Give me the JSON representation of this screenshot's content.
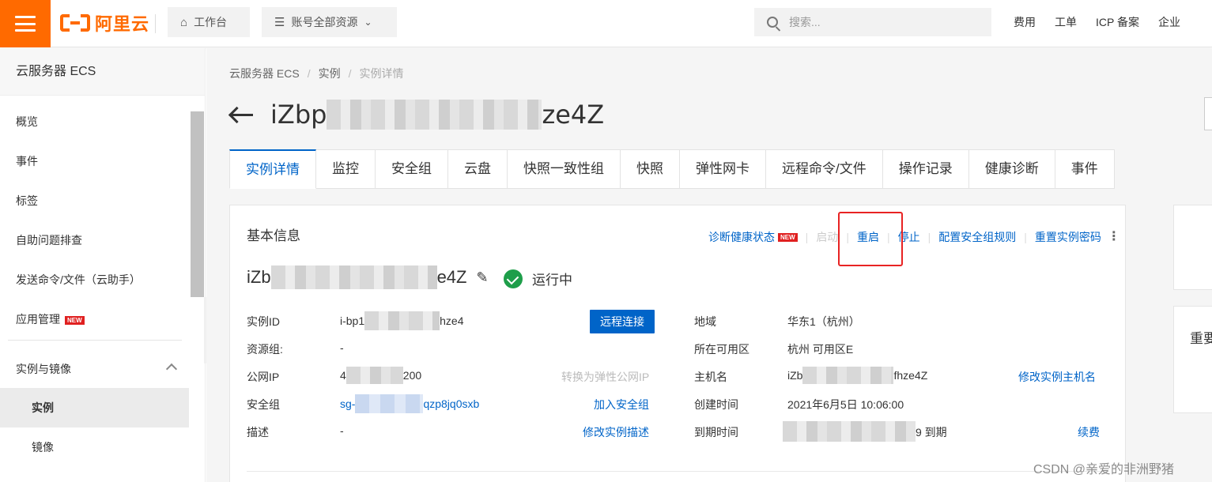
{
  "topbar": {
    "brand": "阿里云",
    "workbench": "工作台",
    "resources": "账号全部资源",
    "search_placeholder": "搜索...",
    "links": [
      "费用",
      "工单",
      "ICP 备案",
      "企业"
    ]
  },
  "sidebar": {
    "title": "云服务器 ECS",
    "items": [
      "概览",
      "事件",
      "标签",
      "自助问题排查",
      "发送命令/文件（云助手）",
      "应用管理"
    ],
    "new_badge": "NEW",
    "group": "实例与镜像",
    "active": "实例",
    "sub": "镜像"
  },
  "breadcrumb": [
    "云服务器 ECS",
    "实例",
    "实例详情"
  ],
  "title": {
    "prefix": "iZbp",
    "suffix": "ze4Z"
  },
  "tabs": [
    "实例详情",
    "监控",
    "安全组",
    "云盘",
    "快照一致性组",
    "快照",
    "弹性网卡",
    "远程命令/文件",
    "操作记录",
    "健康诊断",
    "事件"
  ],
  "card": {
    "title": "基本信息",
    "actions": {
      "diagnose": "诊断健康状态",
      "new": "NEW",
      "start": "启动",
      "restart": "重启",
      "stop": "停止",
      "security_rules": "配置安全组规则",
      "reset_password": "重置实例密码"
    },
    "instance_name": {
      "prefix": "iZb",
      "suffix": "e4Z"
    },
    "status": "运行中",
    "left": [
      {
        "label": "实例ID",
        "value_prefix": "i-bp1",
        "value_suffix": "hze4"
      },
      {
        "label": "资源组:",
        "value": "-"
      },
      {
        "label": "公网IP",
        "value_prefix": "4",
        "value_suffix": "200"
      },
      {
        "label": "安全组",
        "value_prefix": "sg-",
        "value_suffix": "qzp8jq0sxb"
      },
      {
        "label": "描述",
        "value": "-"
      }
    ],
    "left_actions": {
      "remote_connect": "远程连接",
      "to_eip": "转换为弹性公网IP",
      "join_sg": "加入安全组",
      "edit_desc": "修改实例描述"
    },
    "right": [
      {
        "label": "地域",
        "value": "华东1（杭州）"
      },
      {
        "label": "所在可用区",
        "value": "杭州 可用区E"
      },
      {
        "label": "主机名",
        "value_prefix": "iZb",
        "value_suffix": "fhze4Z"
      },
      {
        "label": "创建时间",
        "value": "2021年6月5日 10:06:00"
      },
      {
        "label": "到期时间",
        "value_suffix": "9 到期"
      }
    ],
    "right_actions": {
      "edit_hostname": "修改实例主机名",
      "renew": "续费"
    }
  },
  "right_panel_text": "重要",
  "watermark": "CSDN @亲爱的非洲野猪",
  "colors": {
    "brand": "#ff6a00",
    "link": "#0064c8",
    "highlight": "#e82323",
    "running": "#1e9e4a"
  }
}
